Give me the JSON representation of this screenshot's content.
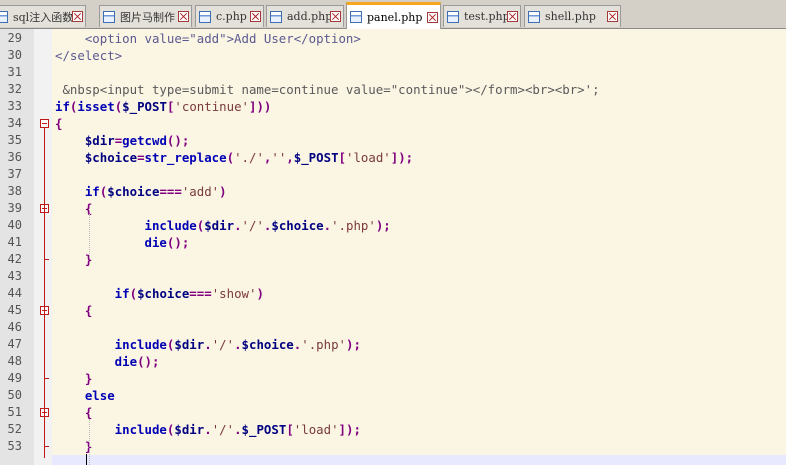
{
  "tabs": [
    {
      "label": "sql注入函数",
      "icon": "php-file-icon",
      "active": false
    },
    {
      "label": "图片马制作",
      "icon": "php-file-icon",
      "active": false
    },
    {
      "label": "c.php",
      "icon": "php-file-icon",
      "active": false
    },
    {
      "label": "add.php",
      "icon": "php-file-icon",
      "active": false
    },
    {
      "label": "panel.php",
      "icon": "php-file-icon",
      "active": true
    },
    {
      "label": "test.php",
      "icon": "php-file-icon",
      "active": false
    },
    {
      "label": "shell.php",
      "icon": "php-file-icon",
      "active": false
    }
  ],
  "colors": {
    "active_tab_accent": "#f5a623",
    "code_background": "#fbf5e4",
    "current_line": "#e8e8ff",
    "fold_marker": "#c01818",
    "keyword": "#0000b4",
    "string": "#7a3b3b",
    "operator": "#800080"
  },
  "editor": {
    "lines": [
      {
        "num": "29",
        "tokens": [
          [
            "html",
            "    <option value=\"add\">Add User</option>"
          ]
        ]
      },
      {
        "num": "30",
        "tokens": [
          [
            "html",
            "</select>"
          ]
        ]
      },
      {
        "num": "31",
        "tokens": []
      },
      {
        "num": "32",
        "tokens": [
          [
            "plain",
            " &nbsp<input type=submit name=continue value=\"continue\"></form><br><br>';"
          ]
        ]
      },
      {
        "num": "33",
        "tokens": [
          [
            "kw",
            "if"
          ],
          [
            "op",
            "("
          ],
          [
            "fn",
            "isset"
          ],
          [
            "op",
            "("
          ],
          [
            "var",
            "$_POST"
          ],
          [
            "op",
            "["
          ],
          [
            "str",
            "'continue'"
          ],
          [
            "op",
            "]))"
          ]
        ]
      },
      {
        "num": "34",
        "tokens": [
          [
            "op",
            "{"
          ]
        ],
        "fold": "open"
      },
      {
        "num": "35",
        "tokens": [
          [
            "var",
            "    $dir"
          ],
          [
            "op",
            "="
          ],
          [
            "fn",
            "getcwd"
          ],
          [
            "op",
            "();"
          ]
        ]
      },
      {
        "num": "36",
        "tokens": [
          [
            "var",
            "    $choice"
          ],
          [
            "op",
            "="
          ],
          [
            "fn",
            "str_replace"
          ],
          [
            "op",
            "("
          ],
          [
            "str",
            "'./'"
          ],
          [
            "op",
            ","
          ],
          [
            "str",
            "''"
          ],
          [
            "op",
            ","
          ],
          [
            "var",
            "$_POST"
          ],
          [
            "op",
            "["
          ],
          [
            "str",
            "'load'"
          ],
          [
            "op",
            "]);"
          ]
        ]
      },
      {
        "num": "37",
        "tokens": []
      },
      {
        "num": "38",
        "tokens": [
          [
            "kw",
            "    if"
          ],
          [
            "op",
            "("
          ],
          [
            "var",
            "$choice"
          ],
          [
            "op",
            "==="
          ],
          [
            "str",
            "'add'"
          ],
          [
            "op",
            ")"
          ]
        ]
      },
      {
        "num": "39",
        "tokens": [
          [
            "op",
            "    {"
          ]
        ],
        "fold": "open"
      },
      {
        "num": "40",
        "tokens": [
          [
            "fn",
            "            include"
          ],
          [
            "op",
            "("
          ],
          [
            "var",
            "$dir"
          ],
          [
            "op",
            "."
          ],
          [
            "str",
            "'/'"
          ],
          [
            "op",
            "."
          ],
          [
            "var",
            "$choice"
          ],
          [
            "op",
            "."
          ],
          [
            "str",
            "'.php'"
          ],
          [
            "op",
            ");"
          ]
        ]
      },
      {
        "num": "41",
        "tokens": [
          [
            "fn",
            "            die"
          ],
          [
            "op",
            "();"
          ]
        ]
      },
      {
        "num": "42",
        "tokens": [
          [
            "op",
            "    }"
          ]
        ],
        "fold": "end"
      },
      {
        "num": "43",
        "tokens": []
      },
      {
        "num": "44",
        "tokens": [
          [
            "kw",
            "        if"
          ],
          [
            "op",
            "("
          ],
          [
            "var",
            "$choice"
          ],
          [
            "op",
            "==="
          ],
          [
            "str",
            "'show'"
          ],
          [
            "op",
            ")"
          ]
        ]
      },
      {
        "num": "45",
        "tokens": [
          [
            "op",
            "    {"
          ]
        ],
        "fold": "open"
      },
      {
        "num": "46",
        "tokens": []
      },
      {
        "num": "47",
        "tokens": [
          [
            "fn",
            "        include"
          ],
          [
            "op",
            "("
          ],
          [
            "var",
            "$dir"
          ],
          [
            "op",
            "."
          ],
          [
            "str",
            "'/'"
          ],
          [
            "op",
            "."
          ],
          [
            "var",
            "$choice"
          ],
          [
            "op",
            "."
          ],
          [
            "str",
            "'.php'"
          ],
          [
            "op",
            ");"
          ]
        ]
      },
      {
        "num": "48",
        "tokens": [
          [
            "fn",
            "        die"
          ],
          [
            "op",
            "();"
          ]
        ]
      },
      {
        "num": "49",
        "tokens": [
          [
            "op",
            "    }"
          ]
        ],
        "fold": "end"
      },
      {
        "num": "50",
        "tokens": [
          [
            "kw",
            "    else"
          ]
        ]
      },
      {
        "num": "51",
        "tokens": [
          [
            "op",
            "    {"
          ]
        ],
        "fold": "open"
      },
      {
        "num": "52",
        "tokens": [
          [
            "fn",
            "        include"
          ],
          [
            "op",
            "("
          ],
          [
            "var",
            "$dir"
          ],
          [
            "op",
            "."
          ],
          [
            "str",
            "'/'"
          ],
          [
            "op",
            "."
          ],
          [
            "var",
            "$_POST"
          ],
          [
            "op",
            "["
          ],
          [
            "str",
            "'load'"
          ],
          [
            "op",
            "]);"
          ]
        ]
      },
      {
        "num": "53",
        "tokens": [
          [
            "op",
            "    }"
          ]
        ],
        "fold": "end"
      },
      {
        "num": "",
        "tokens": [],
        "current": true
      }
    ]
  }
}
